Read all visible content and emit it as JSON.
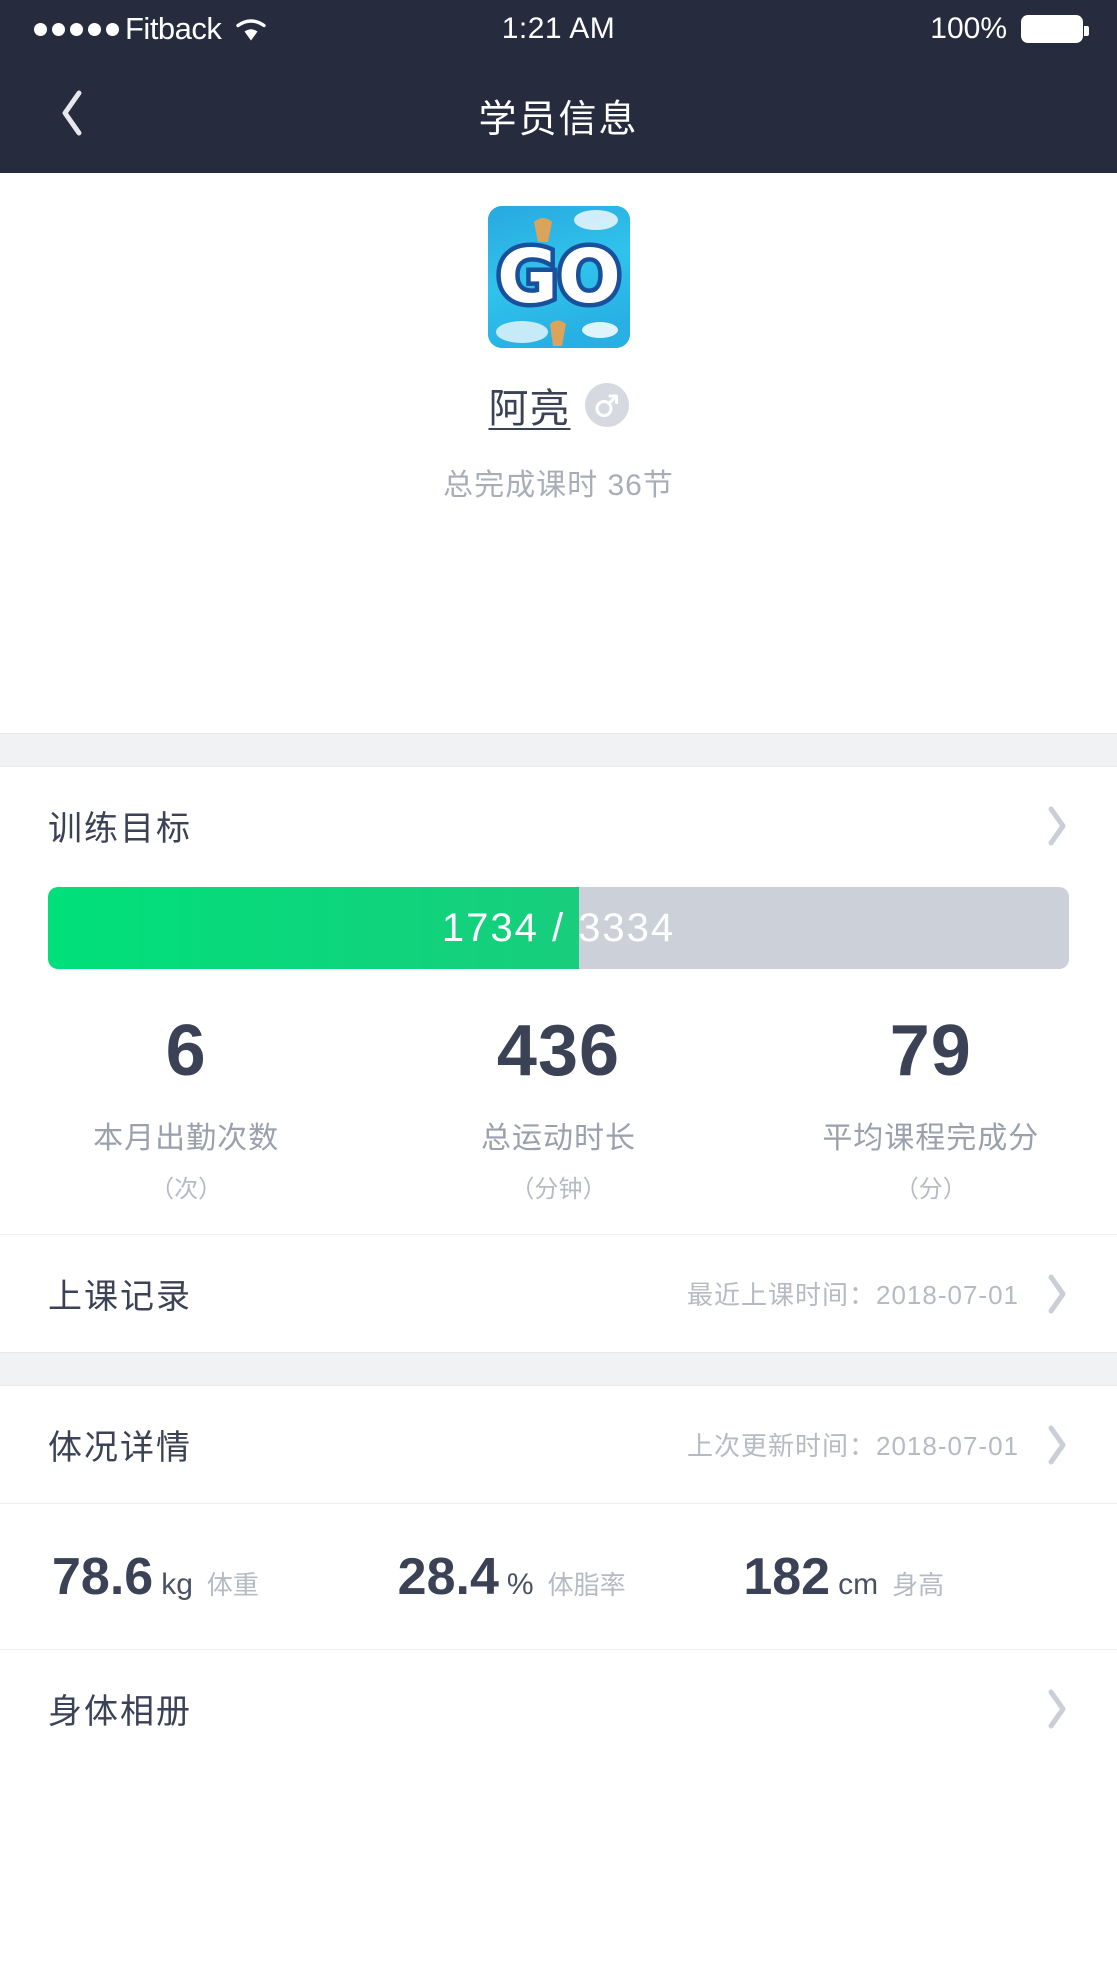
{
  "status_bar": {
    "carrier": "Fitback",
    "signal_dots": 5,
    "wifi_icon": "wifi-icon",
    "time": "1:21 AM",
    "battery_percent": "100%",
    "battery_icon": "battery-full-icon"
  },
  "nav": {
    "back_icon": "chevron-left-icon",
    "title": "学员信息"
  },
  "profile": {
    "avatar_icon": "avatar-go-logo",
    "avatar_text": "GO",
    "name": "阿亮",
    "gender_icon": "male-gender-icon",
    "gender_symbol": "♂",
    "subtitle": "总完成课时 36节"
  },
  "training_goal": {
    "title": "训练目标",
    "chevron_icon": "chevron-right-icon",
    "progress": {
      "current": 1734,
      "target": 3334,
      "label": "1734 / 3334",
      "percent": 52,
      "fill_color": "#00e07a",
      "track_color": "#ccd1d9"
    },
    "stats": [
      {
        "value": "6",
        "label": "本月出勤次数",
        "unit": "（次）"
      },
      {
        "value": "436",
        "label": "总运动时长",
        "unit": "（分钟）"
      },
      {
        "value": "79",
        "label": "平均课程完成分",
        "unit": "（分）"
      }
    ]
  },
  "class_record": {
    "title": "上课记录",
    "meta": "最近上课时间：2018-07-01",
    "chevron_icon": "chevron-right-icon"
  },
  "body_detail": {
    "title": "体况详情",
    "meta": "上次更新时间：2018-07-01",
    "chevron_icon": "chevron-right-icon",
    "metrics": [
      {
        "value": "78.6",
        "unit": "kg",
        "name": "体重"
      },
      {
        "value": "28.4",
        "unit": "%",
        "name": "体脂率"
      },
      {
        "value": "182",
        "unit": "cm",
        "name": "身高"
      }
    ]
  },
  "body_album": {
    "title": "身体相册",
    "chevron_icon": "chevron-right-icon"
  },
  "colors": {
    "header_bg": "#262b3d",
    "text_primary": "#3b4256",
    "text_muted": "#b6bac3",
    "accent_green": "#00e07a",
    "band_bg": "#f1f2f4"
  }
}
